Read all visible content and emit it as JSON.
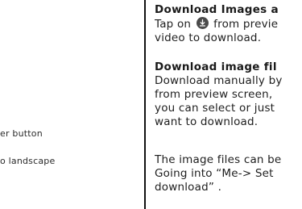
{
  "left_column": {
    "lines": [
      "er button",
      "o landscape"
    ]
  },
  "right_column": {
    "section1": {
      "heading": "Download Images a",
      "line1_before": "Tap on",
      "line1_icon": "download-icon",
      "line1_after": "from previe",
      "line2": "video to download."
    },
    "section2": {
      "heading": "Download image fil",
      "lines": [
        "Download manually by",
        "from preview screen,",
        "you can select or just",
        "want to download."
      ]
    },
    "section3": {
      "lines": [
        "The image files can be",
        "Going into  “Me-> Set",
        "download” ."
      ]
    }
  },
  "colors": {
    "text": "#1e1e1e",
    "divider": "#111111",
    "icon_bg": "#4a4a4a"
  }
}
